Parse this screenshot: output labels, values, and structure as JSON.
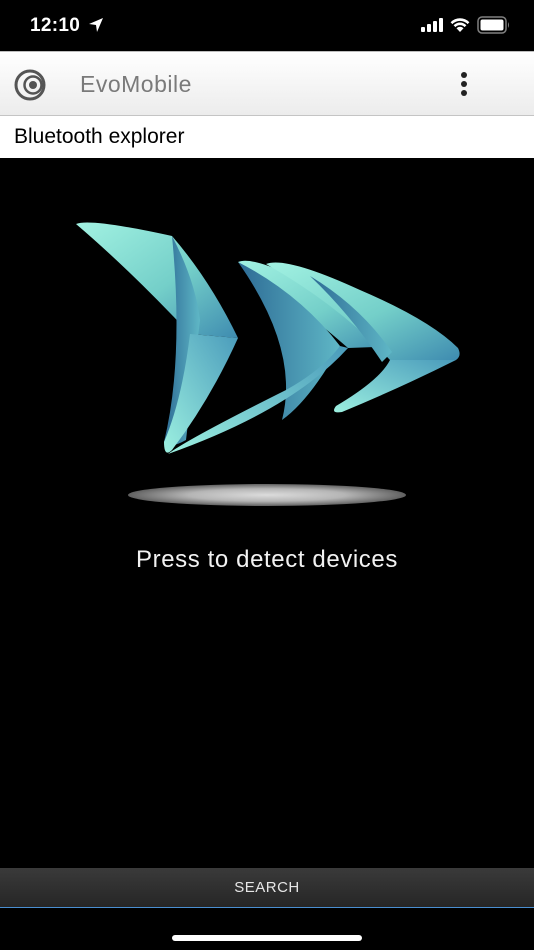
{
  "status_bar": {
    "time": "12:10"
  },
  "app_bar": {
    "title": "EvoMobile",
    "icons": {
      "logo": "evomobile-logo-icon",
      "menu": "more-vert-icon"
    }
  },
  "page": {
    "subtitle": "Bluetooth explorer"
  },
  "main": {
    "prompt": "Press to detect devices",
    "logo_colors": {
      "light": "#8ee8d8",
      "mid": "#5fb8c4",
      "dark": "#2f6f98"
    }
  },
  "bottom_bar": {
    "search_label": "SEARCH"
  }
}
